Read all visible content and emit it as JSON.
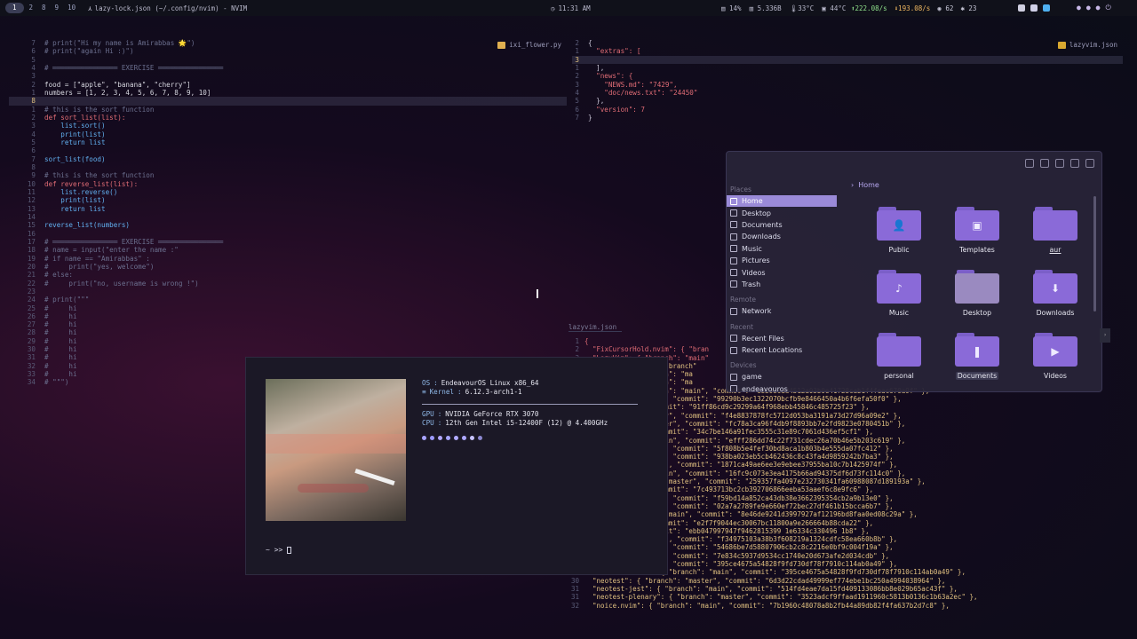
{
  "topbar": {
    "workspaces": [
      "1",
      "2",
      "8",
      "9",
      "10"
    ],
    "window_title": "lazy-lock.json (~/.config/nvim) - NVIM",
    "clock": "11:31 AM",
    "cpu": "14%",
    "mem": "5.336B",
    "temp1": "33°C",
    "temp2": "44°C",
    "net_up": "222.08/s",
    "net_down": "193.08/s",
    "counter1": "62",
    "counter2": "23"
  },
  "left_editor": {
    "filename": "ixi_flower.py",
    "lines": [
      {
        "n": "7",
        "t": "# print(\"Hi my name is Amirabbas 🌟\")",
        "c": "comment"
      },
      {
        "n": "6",
        "t": "# print(\"again Hi :)\")",
        "c": "comment"
      },
      {
        "n": "5",
        "t": "",
        "c": "plain"
      },
      {
        "n": "4",
        "t": "# ════════════════ EXERCISE ════════════════",
        "c": "comment"
      },
      {
        "n": "3",
        "t": "",
        "c": "plain"
      },
      {
        "n": "2",
        "t": "food = [\"apple\", \"banana\", \"cherry\"]",
        "c": "assign"
      },
      {
        "n": "1",
        "t": "numbers = [1, 2, 3, 4, 5, 6, 7, 8, 9, 10]",
        "c": "assign"
      },
      {
        "n": "8",
        "t": "",
        "c": "cur"
      },
      {
        "n": "1",
        "t": "# this is the sort function",
        "c": "comment"
      },
      {
        "n": "2",
        "t": "def sort_list(list):",
        "c": "def"
      },
      {
        "n": "3",
        "t": "    list.sort()",
        "c": "call"
      },
      {
        "n": "4",
        "t": "    print(list)",
        "c": "call"
      },
      {
        "n": "5",
        "t": "    return list",
        "c": "ret"
      },
      {
        "n": "6",
        "t": "",
        "c": "plain"
      },
      {
        "n": "7",
        "t": "sort_list(food)",
        "c": "call"
      },
      {
        "n": "8",
        "t": "",
        "c": "plain"
      },
      {
        "n": "9",
        "t": "# this is the sort function",
        "c": "comment"
      },
      {
        "n": "10",
        "t": "def reverse_list(list):",
        "c": "def"
      },
      {
        "n": "11",
        "t": "    list.reverse()",
        "c": "call"
      },
      {
        "n": "12",
        "t": "    print(list)",
        "c": "call"
      },
      {
        "n": "13",
        "t": "    return list",
        "c": "ret"
      },
      {
        "n": "14",
        "t": "",
        "c": "plain"
      },
      {
        "n": "15",
        "t": "reverse_list(numbers)",
        "c": "call"
      },
      {
        "n": "16",
        "t": "",
        "c": "plain"
      },
      {
        "n": "17",
        "t": "# ════════════════ EXERCISE ════════════════",
        "c": "comment"
      },
      {
        "n": "18",
        "t": "# name = input(\"enter the name :\"",
        "c": "comment"
      },
      {
        "n": "19",
        "t": "# if name == \"Amirabbas\" :",
        "c": "comment"
      },
      {
        "n": "20",
        "t": "#     print(\"yes, welcome\")",
        "c": "comment"
      },
      {
        "n": "21",
        "t": "# else:",
        "c": "comment"
      },
      {
        "n": "22",
        "t": "#     print(\"no, username is wrong !\")",
        "c": "comment"
      },
      {
        "n": "23",
        "t": "",
        "c": "plain"
      },
      {
        "n": "24",
        "t": "# print(\"\"\"",
        "c": "comment"
      },
      {
        "n": "25",
        "t": "#     hi",
        "c": "comment"
      },
      {
        "n": "26",
        "t": "#     hi",
        "c": "comment"
      },
      {
        "n": "27",
        "t": "#     hi",
        "c": "comment"
      },
      {
        "n": "28",
        "t": "#     hi",
        "c": "comment"
      },
      {
        "n": "29",
        "t": "#     hi",
        "c": "comment"
      },
      {
        "n": "30",
        "t": "#     hi",
        "c": "comment"
      },
      {
        "n": "31",
        "t": "#     hi",
        "c": "comment"
      },
      {
        "n": "32",
        "t": "#     hi",
        "c": "comment"
      },
      {
        "n": "33",
        "t": "#     hi",
        "c": "comment"
      },
      {
        "n": "34",
        "t": "# \"\"\")",
        "c": "comment"
      }
    ]
  },
  "right_top_editor": {
    "filename": "lazyvim.json",
    "lines": [
      {
        "n": "2",
        "t": "{"
      },
      {
        "n": "1",
        "t": "  \"extras\": ["
      },
      {
        "n": "3",
        "t": "    "
      },
      {
        "n": "1",
        "t": "  ],"
      },
      {
        "n": "2",
        "t": "  \"news\": {"
      },
      {
        "n": "3",
        "t": "    \"NEWS.md\": \"7429\","
      },
      {
        "n": "4",
        "t": "    \"doc/news.txt\": \"24450\""
      },
      {
        "n": "5",
        "t": "  },"
      },
      {
        "n": "6",
        "t": "  \"version\": 7"
      },
      {
        "n": "7",
        "t": "}"
      }
    ]
  },
  "lock_editor": {
    "filename": "lazyvim.json",
    "lines": [
      {
        "n": "1",
        "t": "{"
      },
      {
        "n": "2",
        "t": "  \"FixCursorHold.nvim\": { \"bran"
      },
      {
        "n": "3",
        "t": "  \"LazyVim\": { \"branch\": \"main\""
      },
      {
        "n": "",
        "t": "              n\": { \"branch\""
      },
      {
        "n": "",
        "t": "              \"branch\": \"ma"
      },
      {
        "n": "",
        "t": "              \"branch\": \"ma"
      },
      {
        "n": "",
        "t": "              \"branch\": \"main\", \"commit\": \"e83986ad4512a03b0e41728cab1f4feac670a9f\" },"
      },
      {
        "n": "",
        "t": "  { \"branch\": \"main\", \"commit\": \"99290b3ec1322070bcfb9e8466450a4b6f6efa50f0\" },"
      },
      {
        "n": "",
        "t": "ranch\": \"main\", \"commit\": \"91ff86cd9c29299a64f968ebb45846c485725f23\" },"
      },
      {
        "n": "",
        "t": "  { \"branch\": \"master\", \"commit\": \"f4e8837878fc5712d053ba3191a73d27d96a09e2\" },"
      },
      {
        "n": "",
        "t": "   { \"branch\": \"master\", \"commit\": \"fc78a3ca96f4db9f8893bb7e2fd9823e0780451b\" },"
      },
      {
        "n": "",
        "t": "branch\": \"main\", \"commit\": \"34c7be146a91fec3555c31e89c7061d436ef5cf1\" },"
      },
      {
        "n": "",
        "t": "ts\": { \"branch\": \"main\", \"commit\": \"efff286dd74c22f731cdec26a70b46e5b203c619\" },"
      },
      {
        "n": "",
        "t": "  { \"branch\": \"main\", \"commit\": \"5f808b5e4fef30bd8aca1b803b4e555da07fc412\" },"
      },
      {
        "n": "",
        "t": "  { \"branch\": \"main\", \"commit\": \"938ba023eb5cb462436c8c43fa4d9859242b7ba3\" },"
      },
      {
        "n": "",
        "t": "\": { \"branch\": \"main\", \"commit\": \"1871ca49ae6ee3e9ebee37955ba10c7b1425974f\" },"
      },
      {
        "n": "",
        "t": "  \": { \"branch\": \"main\", \"commit\": \"16fc9c073e3ea4175b66ad94375df6d73fc114c0\" },"
      },
      {
        "n": "",
        "t": ".nvim\": { \"branch\": \"master\", \"commit\": \"259357fa4097e232730341fa60988087d189193a\" },"
      },
      {
        "n": "",
        "t": "branch\": \"main\", \"commit\": \"7c493713bc2cb392706866eeba53aaef6c8e9fc6\" },"
      },
      {
        "n": "",
        "t": "  { \"branch\": \"main\", \"commit\": \"f59bd14a852ca43db38e3662395354cb2a9b13e0\" },"
      },
      {
        "n": "",
        "t": "  { \"branch\": \"main\", \"commit\": \"02a7a2789fe9e660ef72bec27df461b15bcca6b7\" },"
      },
      {
        "n": "",
        "t": ".nvim\": { \"branch\": \"main\", \"commit\": \"8e46de9241d3997927af12196bd8faa0ed08c29a\" },"
      },
      {
        "n": "",
        "t": "branch\": \"main\", \"commit\": \"e2f7f9044ec30067bc11800a9e266664b88cda22\" },"
      },
      {
        "n": "",
        "t": "anch\": \"main\", \"commit\": \"ebb047997947f9462815399 1e6334c330496 1b8\" },"
      },
      {
        "n": "",
        "t": "\": { \"branch\": \"main\", \"commit\": \"f34975103a38b3f608219a1324cdfc58ea660b8b\" },"
      },
      {
        "n": "",
        "t": "  { \"branch\": \"main\", \"commit\": \"54686be7d58807906cb2c8c2216e0bf9c004f19a\" },"
      },
      {
        "n": "",
        "t": "  { \"branch\": \"main\", \"commit\": \"7e834c5937d9534cc1740e20d673afe2d034cdb\" },"
      },
      {
        "n": "",
        "t": "  { \"branch\": \"main\", \"commit\": \"395ce4675a54828f9fd730df78f7910c114ab0a49\" },"
      },
      {
        "n": "29",
        "t": "  \"neo-tree.nvim\": { \"branch\": \"main\", \"commit\": \"395ce4675a54828f9fd730df78f7910c114ab0a49\" },"
      },
      {
        "n": "30",
        "t": "  \"neotest\": { \"branch\": \"master\", \"commit\": \"6d3d22cdad49999ef774ebe1bc250a4994038964\" },"
      },
      {
        "n": "31",
        "t": "  \"neotest-jest\": { \"branch\": \"main\", \"commit\": \"514fd4eae7da15fd409133086bb8e029b65ac43f\" },"
      },
      {
        "n": "31",
        "t": "  \"neotest-plenary\": { \"branch\": \"master\", \"commit\": \"3523adcf9ffaad1911960c5813b0136c1b63a2ec\" },"
      },
      {
        "n": "32",
        "t": "  \"noice.nvim\": { \"branch\": \"main\", \"commit\": \"7b1960c48078a8b2fb44a89db82f4fa637b2d7c8\" },"
      }
    ]
  },
  "fastfetch": {
    "os_label": "OS",
    "os_value": "EndeavourOS Linux x86_64",
    "kernel_label": "Kernel",
    "kernel_value": "6.12.3-arch1-1",
    "gpu_label": "GPU",
    "gpu_value": "NVIDIA GeForce RTX 3070",
    "cpu_label": "CPU",
    "cpu_value": "12th Gen Intel i5-12400F (12) @ 4.400GHz",
    "dot_colors": [
      "#a9a4ff",
      "#9d9aff",
      "#b3a9ff",
      "#a8a6ff",
      "#b1abff",
      "#aea8ff",
      "#c8c4ff",
      "#8c88d0"
    ],
    "prompt": "~ >> "
  },
  "file_manager": {
    "breadcrumb": "Home",
    "sections": {
      "places": "Places",
      "remote": "Remote",
      "recent": "Recent",
      "devices": "Devices"
    },
    "places": [
      "Home",
      "Desktop",
      "Documents",
      "Downloads",
      "Music",
      "Pictures",
      "Videos",
      "Trash"
    ],
    "remote": [
      "Network"
    ],
    "recent": [
      "Recent Files",
      "Recent Locations"
    ],
    "devices": [
      "game",
      "endeavouros"
    ],
    "folders": [
      {
        "label": "Public",
        "icon": "person-icon",
        "glyph": "👤"
      },
      {
        "label": "Templates",
        "icon": "template-icon",
        "glyph": "▣"
      },
      {
        "label": "aur",
        "icon": "folder-icon",
        "glyph": ""
      },
      {
        "label": "Music",
        "icon": "music-icon",
        "glyph": "♪"
      },
      {
        "label": "Desktop",
        "icon": "desktop-icon",
        "glyph": ""
      },
      {
        "label": "Downloads",
        "icon": "download-icon",
        "glyph": "⬇"
      },
      {
        "label": "personal",
        "icon": "folder-icon",
        "glyph": ""
      },
      {
        "label": "Documents",
        "icon": "document-icon",
        "glyph": "❚"
      },
      {
        "label": "Videos",
        "icon": "video-icon",
        "glyph": "▶"
      }
    ]
  }
}
